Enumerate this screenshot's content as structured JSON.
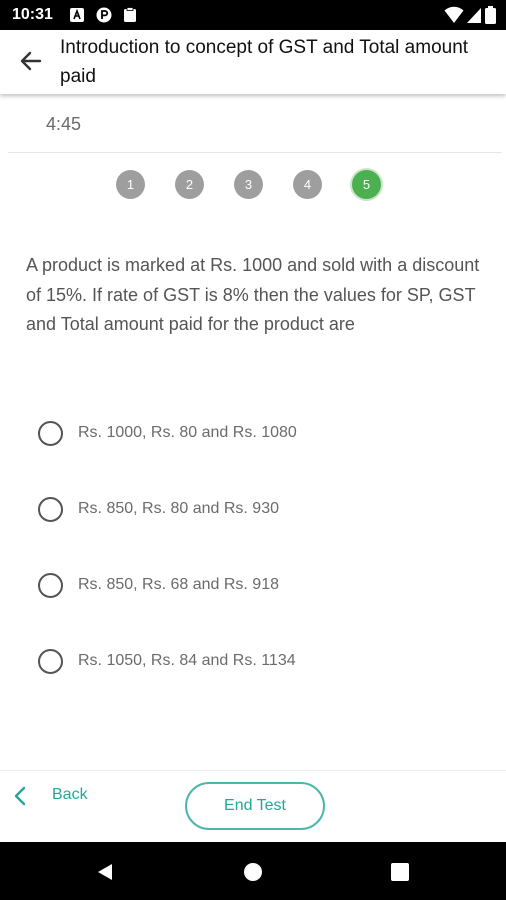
{
  "status_bar": {
    "time": "10:31"
  },
  "header": {
    "title": "Introduction to concept of GST and Total amount paid"
  },
  "timer": "4:45",
  "question_nav": [
    {
      "number": "1",
      "state": "done"
    },
    {
      "number": "2",
      "state": "done"
    },
    {
      "number": "3",
      "state": "done"
    },
    {
      "number": "4",
      "state": "done"
    },
    {
      "number": "5",
      "state": "current"
    }
  ],
  "question": {
    "text": "A product is marked at Rs. 1000 and sold with a discount of 15%. If rate of GST is 8% then the values for SP, GST and Total amount paid for the product are"
  },
  "options": [
    {
      "label": "Rs. 1000, Rs. 80 and Rs. 1080",
      "selected": false
    },
    {
      "label": "Rs. 850, Rs. 80 and Rs. 930",
      "selected": false
    },
    {
      "label": "Rs. 850, Rs. 68 and Rs. 918",
      "selected": false
    },
    {
      "label": "Rs. 1050, Rs. 84 and Rs. 1134",
      "selected": false
    }
  ],
  "footer": {
    "back_label": "Back",
    "end_test_label": "End Test"
  },
  "colors": {
    "accent": "#26a69a",
    "current_question": "#4caf50",
    "question_dot": "#9e9e9e"
  },
  "icons": {
    "status": [
      "a-icon",
      "p-icon",
      "clipboard-icon",
      "wifi-icon",
      "signal-icon",
      "battery-icon"
    ],
    "nav": [
      "nav-back-icon",
      "nav-home-icon",
      "nav-recents-icon"
    ]
  }
}
